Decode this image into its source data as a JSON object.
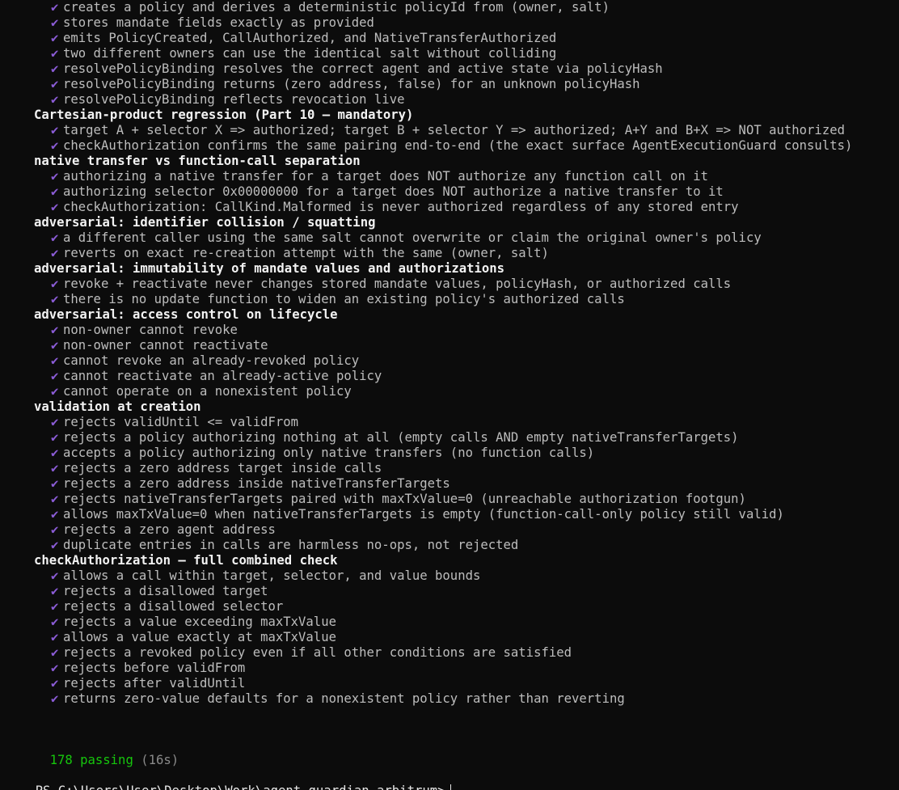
{
  "lines": [
    {
      "kind": "test",
      "text": "creates a policy and derives a deterministic policyId from (owner, salt)"
    },
    {
      "kind": "test",
      "text": "stores mandate fields exactly as provided"
    },
    {
      "kind": "test",
      "text": "emits PolicyCreated, CallAuthorized, and NativeTransferAuthorized"
    },
    {
      "kind": "test",
      "text": "two different owners can use the identical salt without colliding"
    },
    {
      "kind": "test",
      "text": "resolvePolicyBinding resolves the correct agent and active state via policyHash"
    },
    {
      "kind": "test",
      "text": "resolvePolicyBinding returns (zero address, false) for an unknown policyHash"
    },
    {
      "kind": "test",
      "text": "resolvePolicyBinding reflects revocation live"
    },
    {
      "kind": "suite",
      "text": "Cartesian-product regression (Part 10 — mandatory)"
    },
    {
      "kind": "test",
      "text": "target A + selector X => authorized; target B + selector Y => authorized; A+Y and B+X => NOT authorized"
    },
    {
      "kind": "test",
      "text": "checkAuthorization confirms the same pairing end-to-end (the exact surface AgentExecutionGuard consults)"
    },
    {
      "kind": "suite",
      "text": "native transfer vs function-call separation"
    },
    {
      "kind": "test",
      "text": "authorizing a native transfer for a target does NOT authorize any function call on it"
    },
    {
      "kind": "test",
      "text": "authorizing selector 0x00000000 for a target does NOT authorize a native transfer to it"
    },
    {
      "kind": "test",
      "text": "checkAuthorization: CallKind.Malformed is never authorized regardless of any stored entry"
    },
    {
      "kind": "suite",
      "text": "adversarial: identifier collision / squatting"
    },
    {
      "kind": "test",
      "text": "a different caller using the same salt cannot overwrite or claim the original owner's policy"
    },
    {
      "kind": "test",
      "text": "reverts on exact re-creation attempt with the same (owner, salt)"
    },
    {
      "kind": "suite",
      "text": "adversarial: immutability of mandate values and authorizations"
    },
    {
      "kind": "test",
      "text": "revoke + reactivate never changes stored mandate values, policyHash, or authorized calls"
    },
    {
      "kind": "test",
      "text": "there is no update function to widen an existing policy's authorized calls"
    },
    {
      "kind": "suite",
      "text": "adversarial: access control on lifecycle"
    },
    {
      "kind": "test",
      "text": "non-owner cannot revoke"
    },
    {
      "kind": "test",
      "text": "non-owner cannot reactivate"
    },
    {
      "kind": "test",
      "text": "cannot revoke an already-revoked policy"
    },
    {
      "kind": "test",
      "text": "cannot reactivate an already-active policy"
    },
    {
      "kind": "test",
      "text": "cannot operate on a nonexistent policy"
    },
    {
      "kind": "suite",
      "text": "validation at creation"
    },
    {
      "kind": "test",
      "text": "rejects validUntil <= validFrom"
    },
    {
      "kind": "test",
      "text": "rejects a policy authorizing nothing at all (empty calls AND empty nativeTransferTargets)"
    },
    {
      "kind": "test",
      "text": "accepts a policy authorizing only native transfers (no function calls)"
    },
    {
      "kind": "test",
      "text": "rejects a zero address target inside calls"
    },
    {
      "kind": "test",
      "text": "rejects a zero address inside nativeTransferTargets"
    },
    {
      "kind": "test",
      "text": "rejects nativeTransferTargets paired with maxTxValue=0 (unreachable authorization footgun)"
    },
    {
      "kind": "test",
      "text": "allows maxTxValue=0 when nativeTransferTargets is empty (function-call-only policy still valid)"
    },
    {
      "kind": "test",
      "text": "rejects a zero agent address"
    },
    {
      "kind": "test",
      "text": "duplicate entries in calls are harmless no-ops, not rejected"
    },
    {
      "kind": "suite",
      "text": "checkAuthorization — full combined check"
    },
    {
      "kind": "test",
      "text": "allows a call within target, selector, and value bounds"
    },
    {
      "kind": "test",
      "text": "rejects a disallowed target"
    },
    {
      "kind": "test",
      "text": "rejects a disallowed selector"
    },
    {
      "kind": "test",
      "text": "rejects a value exceeding maxTxValue"
    },
    {
      "kind": "test",
      "text": "allows a value exactly at maxTxValue"
    },
    {
      "kind": "test",
      "text": "rejects a revoked policy even if all other conditions are satisfied"
    },
    {
      "kind": "test",
      "text": "rejects before validFrom"
    },
    {
      "kind": "test",
      "text": "rejects after validUntil"
    },
    {
      "kind": "test",
      "text": "returns zero-value defaults for a nonexistent policy rather than reverting"
    }
  ],
  "check_glyph": "✔",
  "summary": {
    "passing": "178 passing",
    "duration": "(16s)"
  },
  "prompt": {
    "text": "PS C:\\Users\\User\\Desktop\\Work\\agent-guardian-arbitrum>"
  },
  "colors": {
    "background": "#0c0c0c",
    "check": "#8b5cd6",
    "passing": "#16c60c",
    "suite": "#f2f2f2",
    "test": "#bdbdbd"
  }
}
